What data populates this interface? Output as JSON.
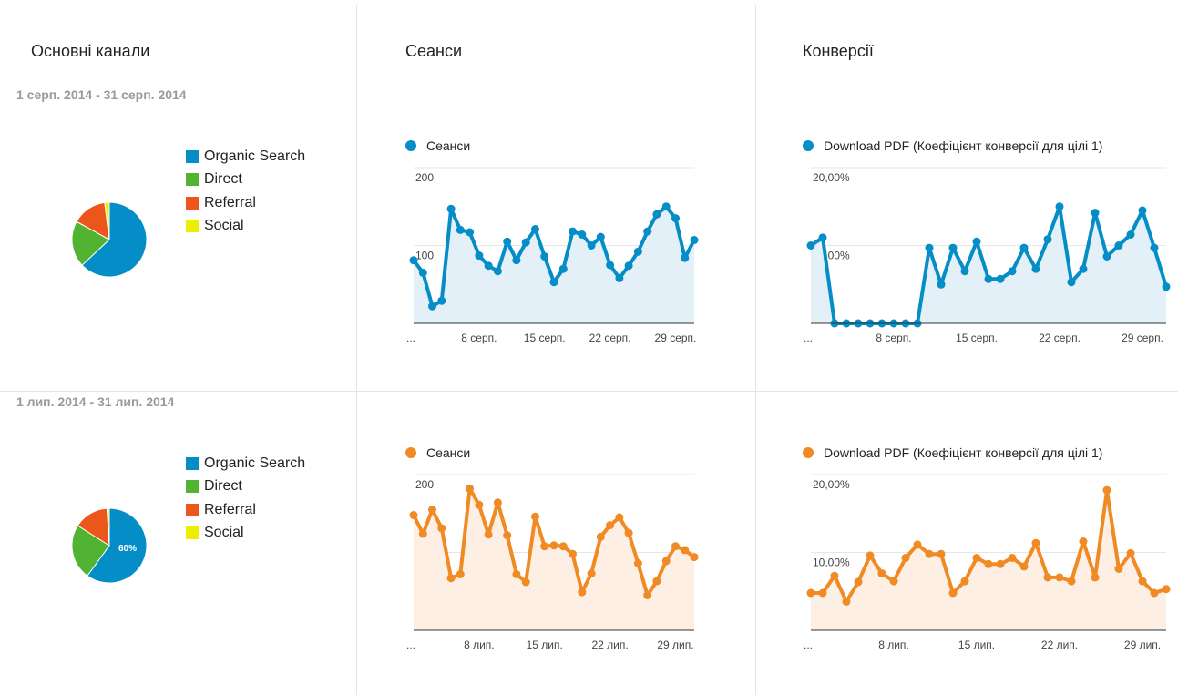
{
  "columns": {
    "channels_title": "Основні канали",
    "sessions_title": "Сеанси",
    "conversions_title": "Конверсії"
  },
  "legend_items": [
    {
      "label": "Organic Search",
      "color": "#058dc7"
    },
    {
      "label": "Direct",
      "color": "#50b432"
    },
    {
      "label": "Referral",
      "color": "#ed561b"
    },
    {
      "label": "Social",
      "color": "#edef00"
    }
  ],
  "rows": [
    {
      "period": "1 серп. 2014 - 31 серп. 2014",
      "color": "#058dc7",
      "fill": "#e3f0f8",
      "pie": {
        "slices": [
          63,
          20,
          15,
          2
        ],
        "label": ""
      },
      "sessions": {
        "legend": "Сеанси",
        "y_labels": [
          "200",
          "100"
        ],
        "x_labels": [
          "...",
          "8 серп.",
          "15 серп.",
          "22 серп.",
          "29 серп."
        ],
        "values": [
          81,
          65,
          22,
          29,
          147,
          120,
          117,
          87,
          74,
          67,
          105,
          81,
          104,
          121,
          86,
          53,
          70,
          118,
          114,
          100,
          111,
          75,
          58,
          74,
          92,
          118,
          140,
          150,
          135,
          84,
          107
        ]
      },
      "conversions": {
        "legend": "Download PDF (Коефіцієнт конверсії для цілі 1)",
        "y_labels": [
          "20,00%",
          "10,00%"
        ],
        "x_labels": [
          "...",
          "8 серп.",
          "15 серп.",
          "22 серп.",
          "29 серп."
        ],
        "values": [
          10,
          11,
          0,
          0,
          0,
          0,
          0,
          0,
          0,
          0,
          9.7,
          5,
          9.7,
          6.7,
          10.5,
          5.7,
          5.7,
          6.7,
          9.7,
          7,
          10.8,
          15,
          5.3,
          7,
          14.2,
          8.6,
          10,
          11.4,
          14.5,
          9.7,
          4.7
        ]
      }
    },
    {
      "period": "1 лип. 2014 - 31 лип. 2014",
      "color": "#f08a24",
      "fill": "#fdefe3",
      "pie": {
        "slices": [
          60,
          24,
          15,
          1
        ],
        "label": "60%"
      },
      "sessions": {
        "legend": "Сеанси",
        "y_labels": [
          "200",
          "100"
        ],
        "x_labels": [
          "...",
          "8 лип.",
          "15 лип.",
          "22 лип.",
          "29 лип."
        ],
        "values": [
          148,
          124,
          155,
          131,
          67,
          72,
          182,
          161,
          123,
          164,
          122,
          72,
          62,
          146,
          108,
          109,
          108,
          98,
          49,
          73,
          120,
          135,
          145,
          125,
          86,
          45,
          63,
          89,
          108,
          103,
          94
        ]
      },
      "conversions": {
        "legend": "Download PDF (Коефіцієнт конверсії для цілі 1)",
        "y_labels": [
          "20,00%",
          "10,00%"
        ],
        "x_labels": [
          "...",
          "8 лип.",
          "15 лип.",
          "22 лип.",
          "29 лип."
        ],
        "values": [
          4.8,
          4.8,
          7,
          3.7,
          6.2,
          9.6,
          7.3,
          6.3,
          9.3,
          11,
          9.8,
          9.8,
          4.8,
          6.3,
          9.3,
          8.5,
          8.5,
          9.3,
          8.2,
          11.2,
          6.8,
          6.8,
          6.3,
          11.4,
          6.8,
          18,
          7.9,
          9.9,
          6.3,
          4.8,
          5.3
        ]
      }
    }
  ]
}
